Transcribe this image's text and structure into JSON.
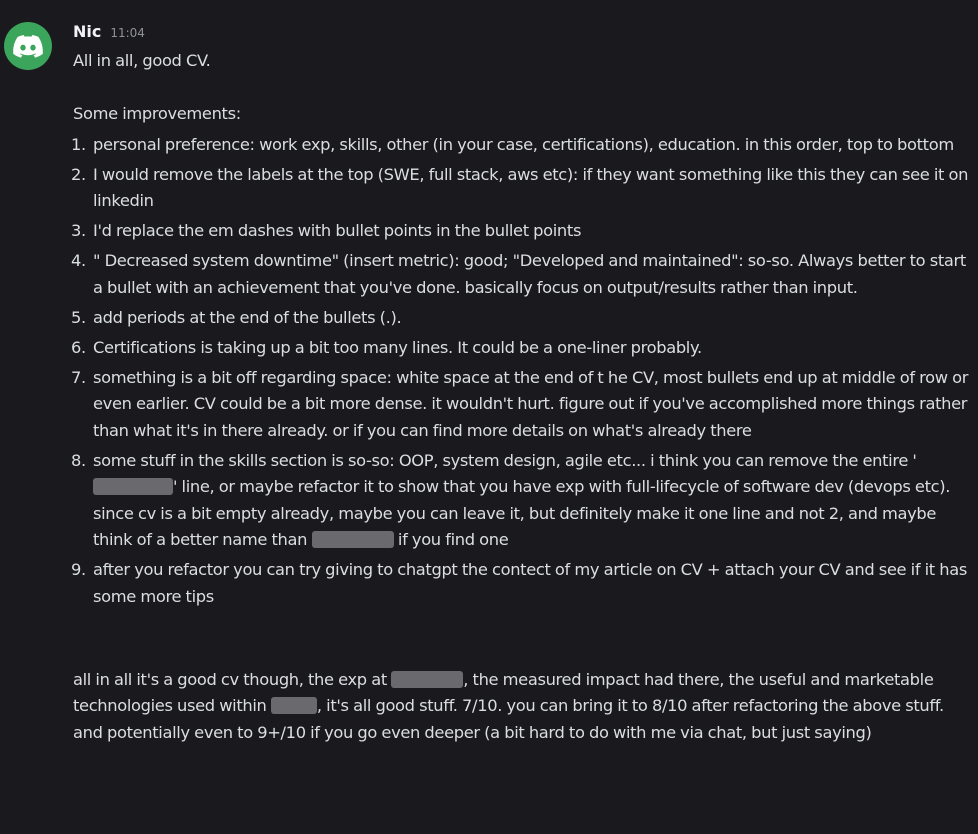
{
  "message": {
    "author": "Nic",
    "timestamp": "11:04",
    "avatar_icon": "discord-logo-icon",
    "avatar_color": "#3ba55c",
    "intro": "All in all, good CV.",
    "list_heading": "Some improvements:",
    "items": [
      {
        "number": "1.",
        "text": "personal preference: work exp, skills, other (in your case, certifications), education. in this order, top to bottom"
      },
      {
        "number": "2.",
        "text": "I would remove the labels at the top (SWE, full stack, aws etc): if they want something like this they can see it on linkedin"
      },
      {
        "number": "3.",
        "text": "I'd replace the em dashes with bullet points in the bullet points"
      },
      {
        "number": "4.",
        "text": "\" Decreased system downtime\" (insert metric): good; \"Developed and maintained\": so-so. Always better to start a bullet with an achievement that you've done. basically focus on output/results rather than input."
      },
      {
        "number": "5.",
        "text": "add periods at the end of the bullets (.)."
      },
      {
        "number": "6.",
        "text": "Certifications is taking up a bit too many lines. It could be a one-liner probably."
      },
      {
        "number": "7.",
        "text": "something is a bit off regarding space: white space at the end of t he CV, most bullets end up at middle of row or even earlier. CV could be a bit more dense. it wouldn't hurt. figure out if you've accomplished more things rather than what it's in there already. or if you can find more details on what's already there"
      },
      {
        "number": "8.",
        "text_a": "some stuff in the skills section is so-so: OOP, system design, agile etc... i think you can remove the entire '",
        "text_b": "' line, or maybe refactor it to show that you have exp with full-lifecycle of software dev (devops etc). since cv is a bit empty already, maybe you can leave it, but definitely make it one line and not 2, and maybe think of a better name than ",
        "text_c": " if you find one"
      },
      {
        "number": "9.",
        "text": "after you refactor you can try giving to chatgpt the contect of my article on CV + attach your CV and see if it has some more tips"
      }
    ],
    "closing_a": "all in all it's a good cv though, the exp at ",
    "closing_b": ", the measured impact had there, the useful and marketable technologies used within ",
    "closing_c": ", it's all good stuff. 7/10. you can bring it to 8/10 after refactoring the above stuff. and potentially even to 9+/10 if you go even deeper (a bit hard to do with me via chat, but just saying)"
  }
}
